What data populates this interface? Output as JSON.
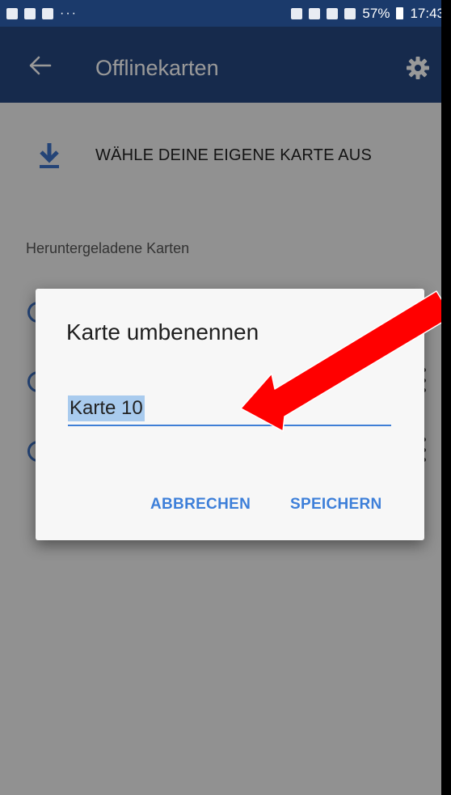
{
  "status_bar": {
    "dots": "···",
    "signal_text": "57%",
    "time": "17:43"
  },
  "app_bar": {
    "title": "Offlinekarten",
    "back_icon": "back-arrow-icon",
    "settings_icon": "gear-icon"
  },
  "content": {
    "download_label": "WÄHLE DEINE EIGENE KARTE AUS",
    "section_label": "Heruntergeladene Karten"
  },
  "dialog": {
    "title": "Karte umbenennen",
    "input_value": "Karte 10",
    "cancel_label": "ABBRECHEN",
    "save_label": "SPEICHERN"
  },
  "colors": {
    "app_bar": "#26467f",
    "status_bar": "#1b3a6b",
    "accent": "#3d7fd9",
    "annotation_arrow": "#ff0000"
  }
}
